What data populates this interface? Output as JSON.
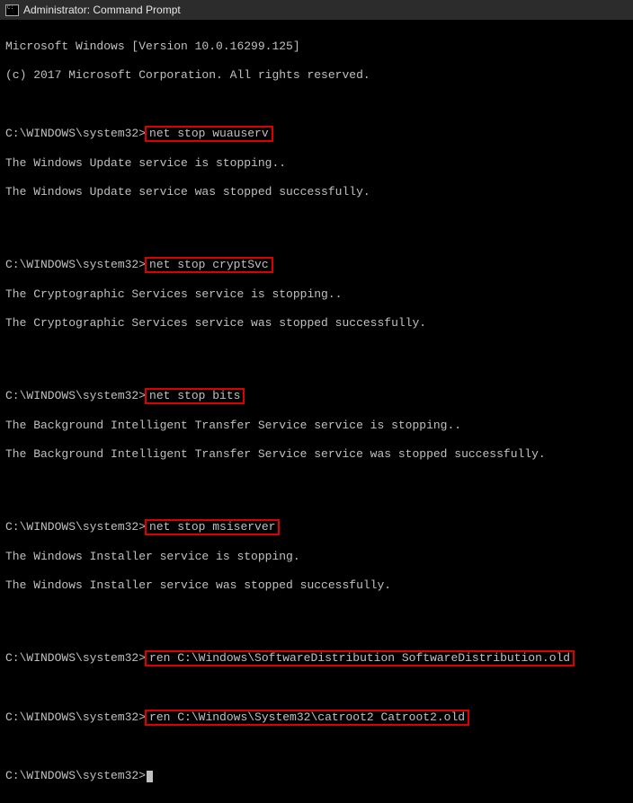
{
  "window": {
    "title": "Administrator: Command Prompt",
    "icon": "cmd-icon"
  },
  "header_lines": [
    "Microsoft Windows [Version 10.0.16299.125]",
    "(c) 2017 Microsoft Corporation. All rights reserved."
  ],
  "prompt": "C:\\WINDOWS\\system32>",
  "blocks": [
    {
      "cmd": "net stop wuauserv",
      "out": [
        "The Windows Update service is stopping..",
        "The Windows Update service was stopped successfully."
      ]
    },
    {
      "cmd": "net stop cryptSvc",
      "out": [
        "The Cryptographic Services service is stopping..",
        "The Cryptographic Services service was stopped successfully."
      ]
    },
    {
      "cmd": "net stop bits",
      "out": [
        "The Background Intelligent Transfer Service service is stopping..",
        "The Background Intelligent Transfer Service service was stopped successfully."
      ]
    },
    {
      "cmd": "net stop msiserver",
      "out": [
        "The Windows Installer service is stopping.",
        "The Windows Installer service was stopped successfully."
      ]
    },
    {
      "cmd": "ren C:\\Windows\\SoftwareDistribution SoftwareDistribution.old",
      "out": []
    },
    {
      "cmd": "ren C:\\Windows\\System32\\catroot2 Catroot2.old",
      "out": []
    }
  ]
}
